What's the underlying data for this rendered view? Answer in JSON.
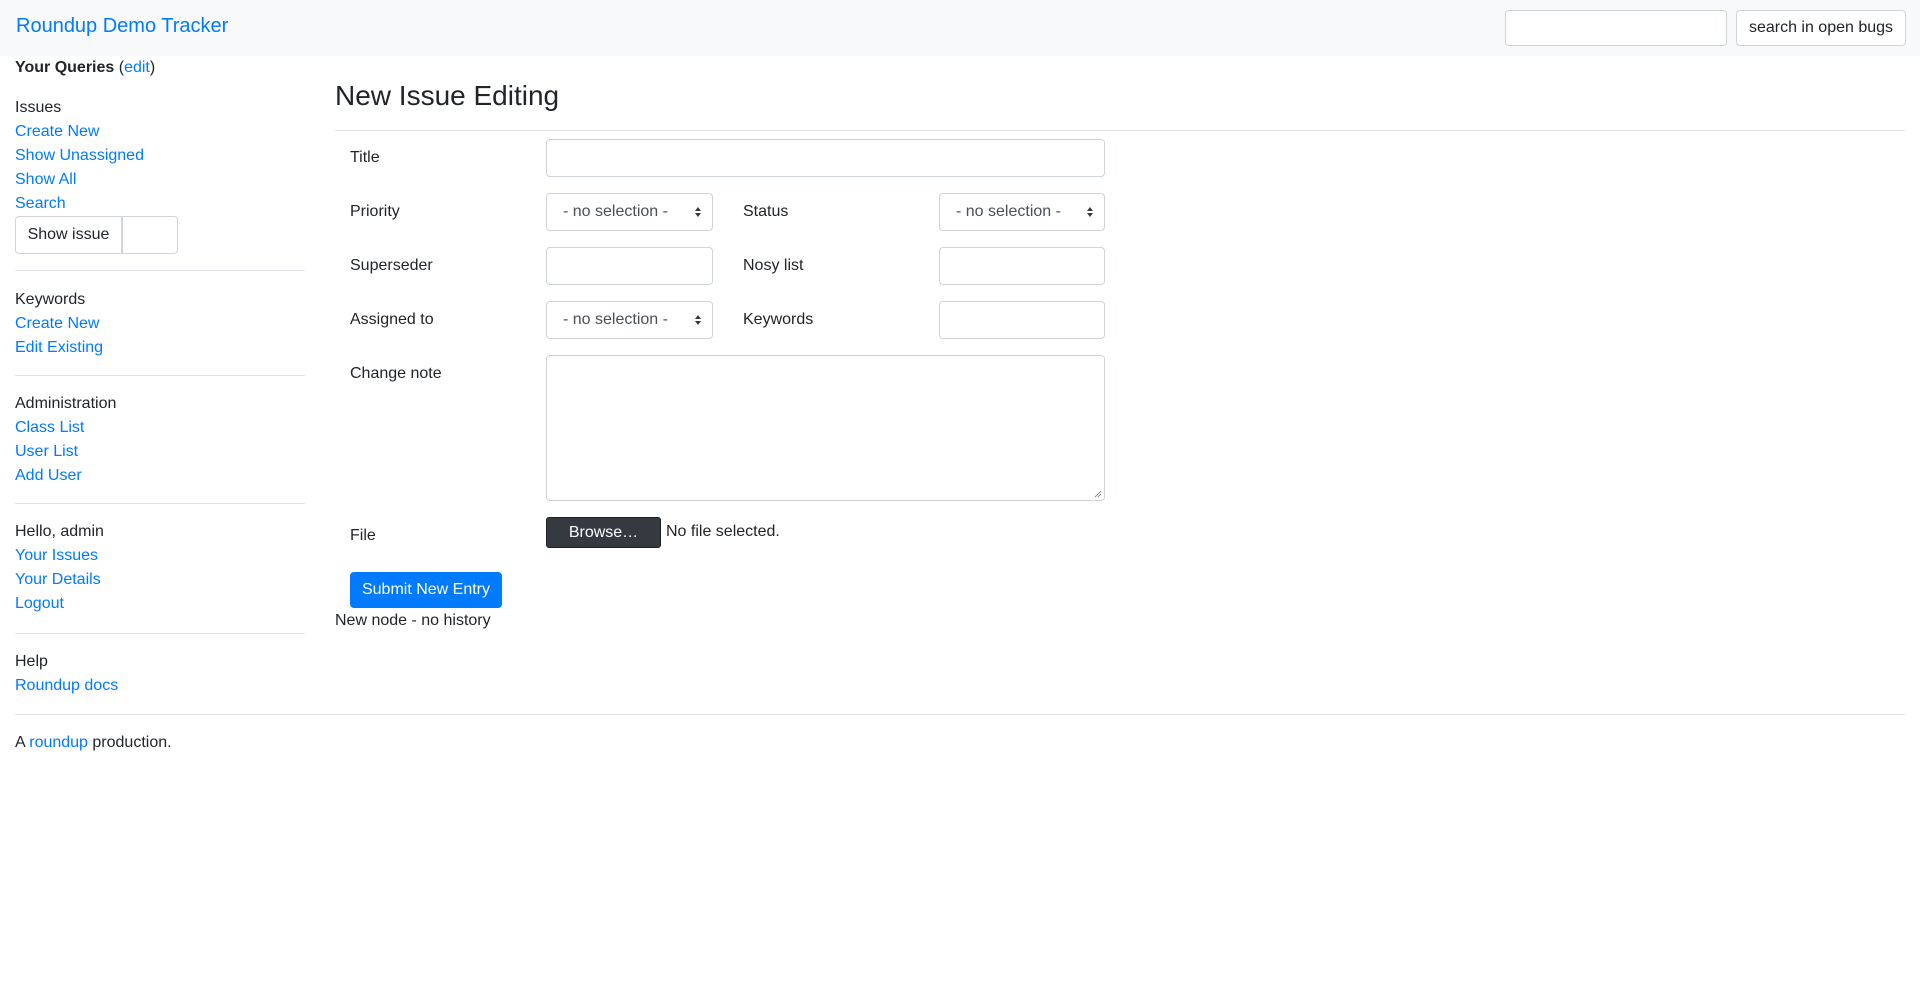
{
  "navbar": {
    "brand": "Roundup Demo Tracker",
    "search_placeholder": "",
    "search_button": "search in open bugs"
  },
  "sidebar": {
    "queries_label": "Your Queries",
    "queries_edit_open": "(",
    "queries_edit": "edit",
    "queries_edit_close": ")",
    "issues": {
      "heading": "Issues",
      "create_new": "Create New",
      "show_unassigned": "Show Unassigned",
      "show_all": "Show All",
      "search": "Search",
      "show_issue_button": "Show issue",
      "show_issue_value": ""
    },
    "keywords": {
      "heading": "Keywords",
      "create_new": "Create New",
      "edit_existing": "Edit Existing"
    },
    "administration": {
      "heading": "Administration",
      "class_list": "Class List",
      "user_list": "User List",
      "add_user": "Add User"
    },
    "user": {
      "greeting": "Hello, admin",
      "your_issues": "Your Issues",
      "your_details": "Your Details",
      "logout": "Logout"
    },
    "help": {
      "heading": "Help",
      "roundup_docs": "Roundup docs"
    }
  },
  "main": {
    "title": "New Issue Editing",
    "form": {
      "title_label": "Title",
      "title_value": "",
      "priority_label": "Priority",
      "priority_value": "- no selection -",
      "status_label": "Status",
      "status_value": "- no selection -",
      "superseder_label": "Superseder",
      "superseder_value": "",
      "nosy_label": "Nosy list",
      "nosy_value": "",
      "assigned_label": "Assigned to",
      "assigned_value": "- no selection -",
      "keywords_label": "Keywords",
      "keywords_value": "",
      "change_note_label": "Change note",
      "change_note_value": "",
      "file_label": "File",
      "browse_button": "Browse…",
      "file_status": "No file selected.",
      "submit_button": "Submit New Entry"
    },
    "history_note": "New node - no history"
  },
  "footer": {
    "prefix": "A ",
    "link": "roundup",
    "suffix": " production."
  },
  "colors": {
    "accent": "#007bff",
    "navbar_bg": "#f8f9fa",
    "dark_button": "#343a40",
    "text": "#212529"
  }
}
